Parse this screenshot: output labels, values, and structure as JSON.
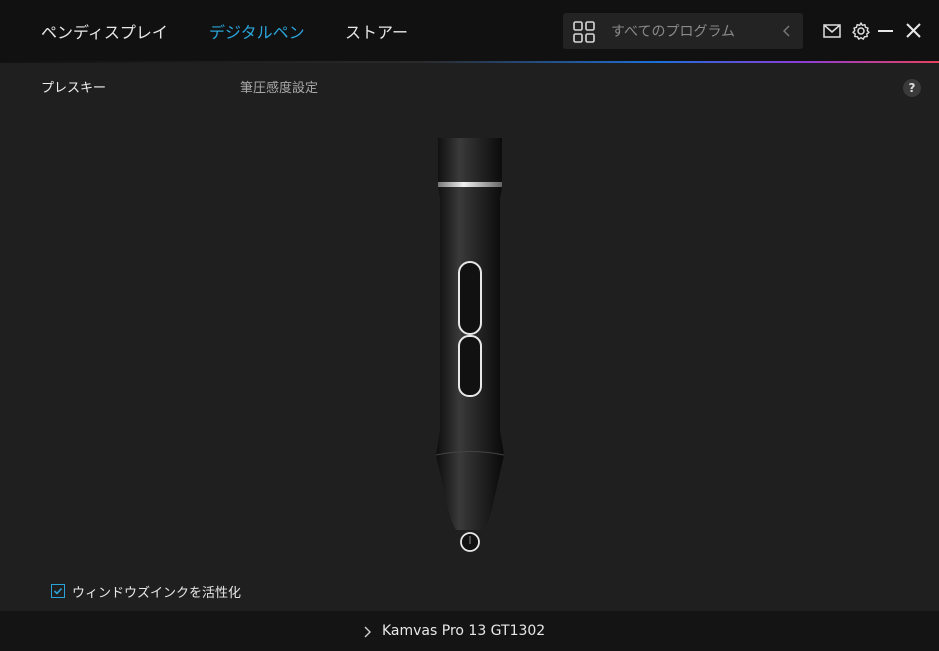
{
  "nav": {
    "tabs": [
      {
        "label": "ペンディスプレイ",
        "active": false
      },
      {
        "label": "デジタルペン",
        "active": true
      },
      {
        "label": "ストアー",
        "active": false
      }
    ]
  },
  "search": {
    "placeholder": "すべてのプログラム",
    "icon": "grid-icon"
  },
  "window_controls": [
    "mail-icon",
    "gear-icon",
    "minimize-icon",
    "close-icon"
  ],
  "subtabs": [
    {
      "label": "プレスキー",
      "active": true
    },
    {
      "label": "筆圧感度設定",
      "active": false
    }
  ],
  "help": {
    "label": "?"
  },
  "checkbox": {
    "label": "ウィンドウズインクを活性化",
    "checked": true
  },
  "device": {
    "name": "Kamvas Pro 13 GT1302"
  },
  "colors": {
    "accent": "#2aa3d8",
    "background": "#1f1f1f",
    "titlebar": "#111111"
  }
}
